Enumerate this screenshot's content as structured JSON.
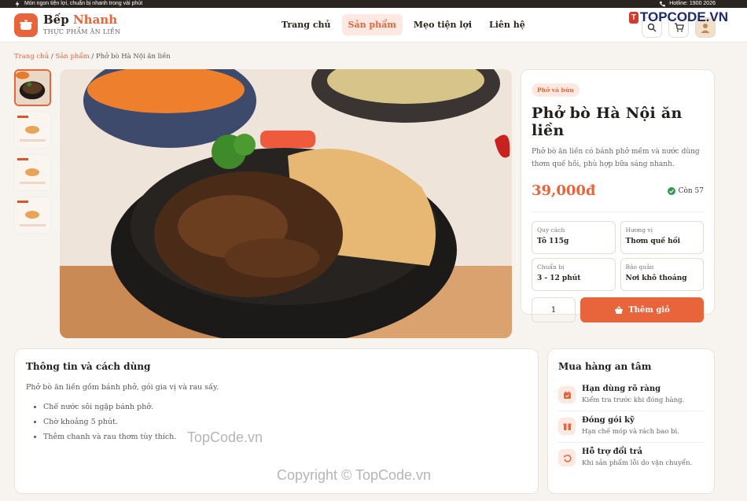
{
  "topbar": {
    "left_text": "Món ngon tiện lợi, chuẩn bị nhanh trong vài phút",
    "right_text": "Hotline: 1900 2026"
  },
  "brand": {
    "name_part1": "Bếp",
    "name_part2": "Nhanh",
    "subtitle": "THỰC PHẨM ĂN LIỀN"
  },
  "nav": [
    {
      "label": "Trang chủ"
    },
    {
      "label": "Sản phẩm"
    },
    {
      "label": "Mẹo tiện lợi"
    },
    {
      "label": "Liên hệ"
    }
  ],
  "watermark_logo": {
    "badge": "T",
    "text": "TOPCODE.VN"
  },
  "breadcrumb": {
    "home": "Trang chủ",
    "sep": " / ",
    "category": "Sản phẩm",
    "current": "Phở bò Hà Nội ăn liền"
  },
  "product": {
    "tag": "Phở và bún",
    "title": "Phở bò Hà Nội ăn liền",
    "description": "Phở bò ăn liền có bánh phở mềm và nước dùng thơm quế hồi, phù hợp bữa sáng nhanh.",
    "price": "39,000đ",
    "stock": "Còn 57",
    "specs": [
      {
        "label": "Quy cách",
        "value": "Tô 115g"
      },
      {
        "label": "Hương vị",
        "value": "Thơm quế hồi"
      },
      {
        "label": "Chuẩn bị",
        "value": "3 - 12 phút"
      },
      {
        "label": "Bảo quản",
        "value": "Nơi khô thoáng"
      }
    ],
    "quantity": "1",
    "add_label": "Thêm giỏ"
  },
  "info": {
    "title": "Thông tin và cách dùng",
    "paragraph": "Phở bò ăn liền gồm bánh phở, gói gia vị và rau sấy.",
    "steps": [
      "Chế nước sôi ngập bánh phở.",
      "Chờ khoảng 5 phút.",
      "Thêm chanh và rau thơm tùy thích."
    ]
  },
  "safe": {
    "title": "Mua hàng an tâm",
    "items": [
      {
        "title": "Hạn dùng rõ ràng",
        "desc": "Kiểm tra trước khi đóng hàng.",
        "icon": "calendar-icon"
      },
      {
        "title": "Đóng gói kỹ",
        "desc": "Hạn chế móp và rách bao bì.",
        "icon": "package-icon"
      },
      {
        "title": "Hỗ trợ đổi trả",
        "desc": "Khi sản phẩm lỗi do vận chuyển.",
        "icon": "return-icon"
      }
    ]
  },
  "watermarks": {
    "mid": "TopCode.vn",
    "bottom": "Copyright © TopCode.vn"
  },
  "colors": {
    "accent": "#e8643a",
    "dark": "#2b2522",
    "accent_soft": "#fde9e1"
  }
}
